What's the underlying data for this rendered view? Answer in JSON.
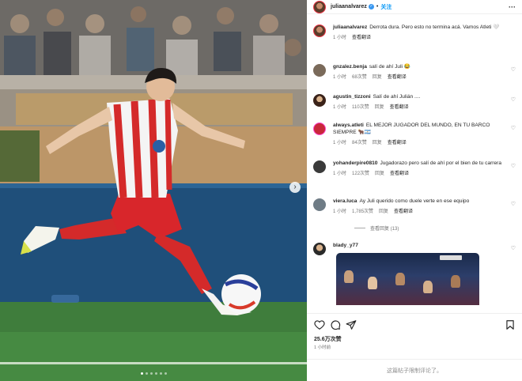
{
  "post": {
    "username": "juliaanalvarez",
    "follow_label": "关注",
    "more_icon": "more-horizontal-icon",
    "caption": "Derrota dura. Pero esto no termina acá. Vamos Atleti 🤍",
    "caption_time": "1 小时",
    "translate_label": "查看翻译"
  },
  "comments": [
    {
      "user": "gnzalez.benja",
      "text": "salí de ahí Juli 😂",
      "time": "1 小时",
      "likes": "68次赞",
      "reply": "回复",
      "translate": "查看翻译"
    },
    {
      "user": "agustin_tizzoni",
      "text": "Salí de ahí Julián ....",
      "time": "1 小时",
      "likes": "110次赞",
      "reply": "回复",
      "translate": "查看翻译"
    },
    {
      "user": "always.atleti",
      "text": "EL MEJOR JUGADOR DEL MUNDO, EN TU BARCO SIEMPRE 🐂🇦🇷",
      "time": "1 小时",
      "likes": "84次赞",
      "reply": "回复",
      "translate": "查看翻译"
    },
    {
      "user": "yohanderpire0810",
      "text": "Jugadorazo pero salí de ahí por el bien de tu carrera",
      "time": "1 小时",
      "likes": "122次赞",
      "reply": "回复",
      "translate": "查看翻译"
    },
    {
      "user": "viera.luca",
      "text": "Ay Juli querido como duele verte en ese equipo",
      "time": "1 小时",
      "likes": "1,785次赞",
      "reply": "回复",
      "translate": "查看翻译"
    },
    {
      "user": "blady_y77",
      "text": "",
      "time": "",
      "likes": "",
      "reply": "",
      "translate": ""
    }
  ],
  "view_replies": "查看回复 (13)",
  "likes_count": "25.6万次赞",
  "post_time": "1 小时前",
  "comments_disabled": "这篇帖子限制评论了。",
  "colors": {
    "accent": "#0095f6",
    "muted": "#737373",
    "verified": "#3897f0"
  },
  "icons": [
    "heart-icon",
    "comment-icon",
    "share-icon",
    "bookmark-icon",
    "verified-icon",
    "chevron-right-icon"
  ]
}
